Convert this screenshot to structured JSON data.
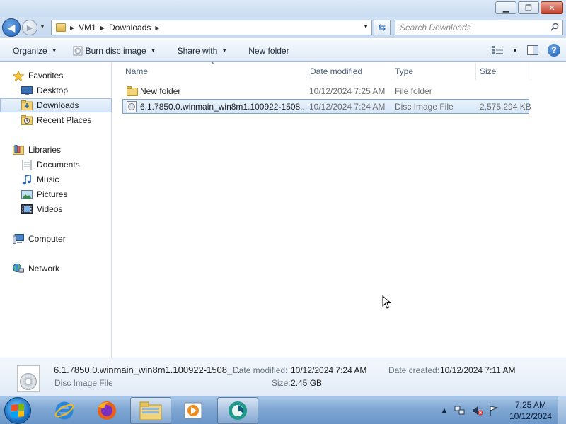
{
  "window": {
    "minimize_icon": "minimize-icon",
    "maximize_icon": "restore-icon",
    "close_icon": "close-icon"
  },
  "nav": {
    "breadcrumb": [
      "VM1",
      "Downloads"
    ],
    "search_placeholder": "Search Downloads"
  },
  "toolbar": {
    "organize": "Organize",
    "burn": "Burn disc image",
    "share": "Share with",
    "new_folder": "New folder"
  },
  "sidebar": {
    "favorites": {
      "label": "Favorites",
      "items": [
        {
          "label": "Desktop",
          "icon": "desktop-icon"
        },
        {
          "label": "Downloads",
          "icon": "downloads-folder-icon",
          "selected": true
        },
        {
          "label": "Recent Places",
          "icon": "recent-places-icon"
        }
      ]
    },
    "libraries": {
      "label": "Libraries",
      "items": [
        {
          "label": "Documents",
          "icon": "documents-icon"
        },
        {
          "label": "Music",
          "icon": "music-icon"
        },
        {
          "label": "Pictures",
          "icon": "pictures-icon"
        },
        {
          "label": "Videos",
          "icon": "videos-icon"
        }
      ]
    },
    "computer": {
      "label": "Computer"
    },
    "network": {
      "label": "Network"
    }
  },
  "columns": {
    "name": "Name",
    "date_modified": "Date modified",
    "type": "Type",
    "size": "Size"
  },
  "files": [
    {
      "name": "New folder",
      "date_modified": "10/12/2024 7:25 AM",
      "type": "File folder",
      "size": "",
      "icon": "folder-icon"
    },
    {
      "name": "6.1.7850.0.winmain_win8m1.100922-1508...",
      "date_modified": "10/12/2024 7:24 AM",
      "type": "Disc Image File",
      "size": "2,575,294 KB",
      "icon": "disc-image-file-icon",
      "selected": true
    }
  ],
  "details": {
    "name": "6.1.7850.0.winmain_win8m1.100922-1508_...",
    "type": "Disc Image File",
    "date_modified_label": "Date modified:",
    "date_modified": "10/12/2024 7:24 AM",
    "date_created_label": "Date created:",
    "date_created": "10/12/2024 7:11 AM",
    "size_label": "Size:",
    "size": "2.45 GB"
  },
  "taskbar": {
    "apps": [
      "internet-explorer-icon",
      "firefox-icon",
      "windows-explorer-icon",
      "media-player-icon",
      "app-icon"
    ],
    "time": "7:25 AM",
    "date": "10/12/2024"
  },
  "colors": {
    "accent": "#1d5fb5",
    "selection_border": "#7da2ce",
    "selection_fill": "#dbe9f9"
  }
}
